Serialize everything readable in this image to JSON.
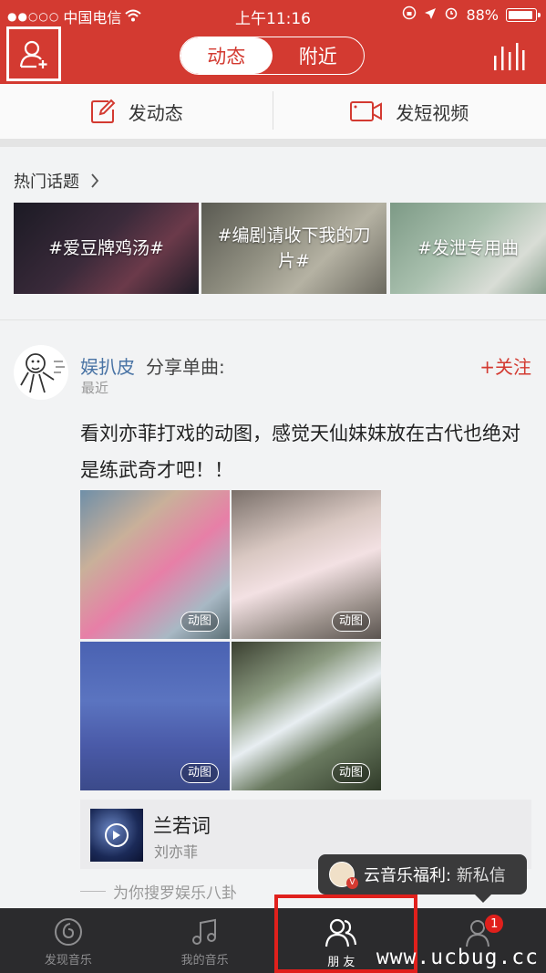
{
  "status_bar": {
    "signal": "●●○○○",
    "carrier": "中国电信",
    "time": "上午11:16",
    "battery": "88%"
  },
  "header": {
    "tabs": [
      {
        "label": "动态",
        "active": true
      },
      {
        "label": "附近",
        "active": false
      }
    ],
    "accent_color": "#d33a31"
  },
  "actions": {
    "post_label": "发动态",
    "video_label": "发短视频"
  },
  "topics": {
    "title": "热门话题",
    "items": [
      {
        "label": "#爱豆牌鸡汤#"
      },
      {
        "label": "#编剧请收下我的刀片#"
      },
      {
        "label": "#发泄专用曲"
      }
    ]
  },
  "post": {
    "user_name": "娱扒皮",
    "share_label": "分享单曲:",
    "time": "最近",
    "follow_label": "+关注",
    "text": "看刘亦菲打戏的动图，感觉天仙妹妹放在古代也绝对是练武奇才吧！！",
    "gif_label": "动图",
    "song": {
      "title": "兰若词",
      "artist": "刘亦菲"
    },
    "source": "为你搜罗娱乐八卦"
  },
  "toast": {
    "sender": "云音乐福利:",
    "message": "新私信",
    "badge": "V"
  },
  "tabbar": {
    "items": [
      {
        "label": "发现音乐",
        "icon": "netease-logo-icon"
      },
      {
        "label": "我的音乐",
        "icon": "music-note-icon"
      },
      {
        "label": "朋 友",
        "icon": "friends-icon",
        "active": true
      },
      {
        "label": "",
        "icon": "account-icon",
        "badge": "1"
      }
    ]
  },
  "watermark": "www.ucbug.cc"
}
